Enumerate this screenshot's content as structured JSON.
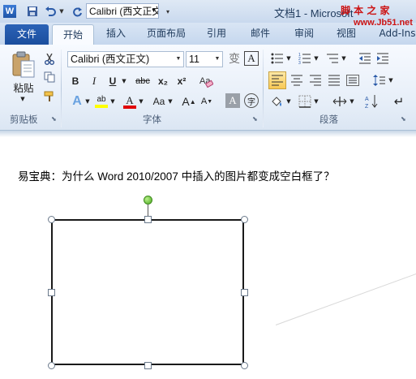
{
  "window": {
    "title": "文档1 - Microsoft Word",
    "app_icon": "W",
    "quick_font": "Calibri (西文正文)"
  },
  "watermark": {
    "text": "脚 本 之 家",
    "url": "www.Jb51.net"
  },
  "tabs": [
    "文件",
    "开始",
    "插入",
    "页面布局",
    "引用",
    "邮件",
    "审阅",
    "视图",
    "Add-Ins"
  ],
  "ribbon": {
    "clipboard": {
      "paste_label": "粘贴",
      "group_label": "剪贴板"
    },
    "font": {
      "font_name": "Calibri (西文正文)",
      "font_size": "11",
      "bold": "B",
      "italic": "I",
      "underline": "U",
      "strike": "abc",
      "subscript": "x₂",
      "superscript": "x²",
      "grow": "A",
      "shrink": "A",
      "case": "Aa",
      "group_label": "字体"
    },
    "paragraph": {
      "group_label": "段落"
    }
  },
  "document": {
    "text": "易宝典：为什么 Word 2010/2007 中插入的图片都变成空白框了？"
  },
  "colors": {
    "file_tab": "#2b62b7",
    "highlight": "#ffff00",
    "font_color": "#e00000",
    "rotate_handle": "#4aa81e"
  }
}
